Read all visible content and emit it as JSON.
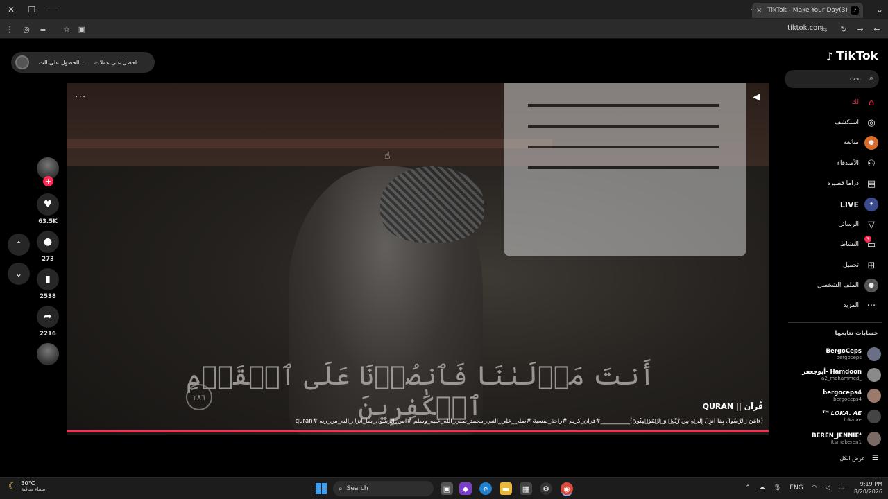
{
  "browser": {
    "tab_title": "(3)TikTok - Make Your Day",
    "tab_close": "×",
    "url": "tiktok.com",
    "window_controls": {
      "close": "✕",
      "restore": "❐",
      "minimize": "—"
    },
    "new_tab": "+",
    "icons": [
      "menu-dots-icon",
      "extension-icon",
      "tab-search-icon",
      "star-icon",
      "translate-icon",
      "customize-icon",
      "reload-icon",
      "back-icon",
      "forward-icon"
    ]
  },
  "top_pill": {
    "get_coins": "احصل على عملات",
    "get_app": "الحصول على الت..."
  },
  "video": {
    "more": "···",
    "arabic_overlay": "أَنتَ مَوۡلَىٰنَا فَٱنصُرۡنَا عَلَى ٱلۡقَوۡمِ ٱلۡكَٰفِرِينَ",
    "ayah_number": "٢٨٦",
    "author": "QURAN || قُرآن",
    "description": "(ءَامَنَ ٱلرَّسُولُ بِمَآ أُنزِلَ إِلَيۡهِ مِن رَّبِّهِۦ وَٱلۡمُؤۡمِنُونَ)__________#قران_كريم #راحة_نفسية #صلي_علي_النبي_محمد_صلي_الله_عليه_وسلم #امن_الرسول_بما_انزل_اليه_من_ربه #quran"
  },
  "actions": {
    "likes": "63.5K",
    "comments": "273",
    "saves": "2538",
    "shares": "2216",
    "follow_plus": "+"
  },
  "sidebar": {
    "logo": "TikTok",
    "search_placeholder": "بحث",
    "nav": [
      {
        "label": "لك",
        "icon": "home-icon",
        "active": true
      },
      {
        "label": "استكشف",
        "icon": "compass-icon"
      },
      {
        "label": "متابَعة",
        "icon": "following-icon"
      },
      {
        "label": "الأصدقاء",
        "icon": "friends-icon"
      },
      {
        "label": "دراما قصيرة",
        "icon": "drama-icon"
      },
      {
        "label": "LIVE",
        "icon": "live-icon"
      },
      {
        "label": "الرسائل",
        "icon": "send-icon"
      },
      {
        "label": "النشاط",
        "icon": "activity-icon",
        "badge": "3"
      },
      {
        "label": "تحميل",
        "icon": "upload-icon"
      },
      {
        "label": "الملف الشخصي",
        "icon": "profile-icon"
      },
      {
        "label": "المزيد",
        "icon": "more-icon"
      }
    ],
    "following_title": "حسابات تتابعها",
    "accounts": [
      {
        "name": "BergoCeps",
        "handle": "bergoceps"
      },
      {
        "name": "أبوجعفر- Hamdoon",
        "handle": "a2_mohammed_"
      },
      {
        "name": "bergoceps4",
        "handle": "bergoceps4"
      },
      {
        "name": "ᵀᴹ 𝙇𝙊𝙆𝘼. 𝘼𝙀",
        "handle": "loka.ae"
      },
      {
        "name": "BEREN_JENNIE⁴",
        "handle": "itsmeberen1"
      }
    ],
    "see_all": "عرض الكل"
  },
  "taskbar": {
    "temp": "30°C",
    "weather": "سماء صافية",
    "search": "Search",
    "lang": "ENG",
    "time": "9:19 PM",
    "date": "8/20/2026"
  }
}
